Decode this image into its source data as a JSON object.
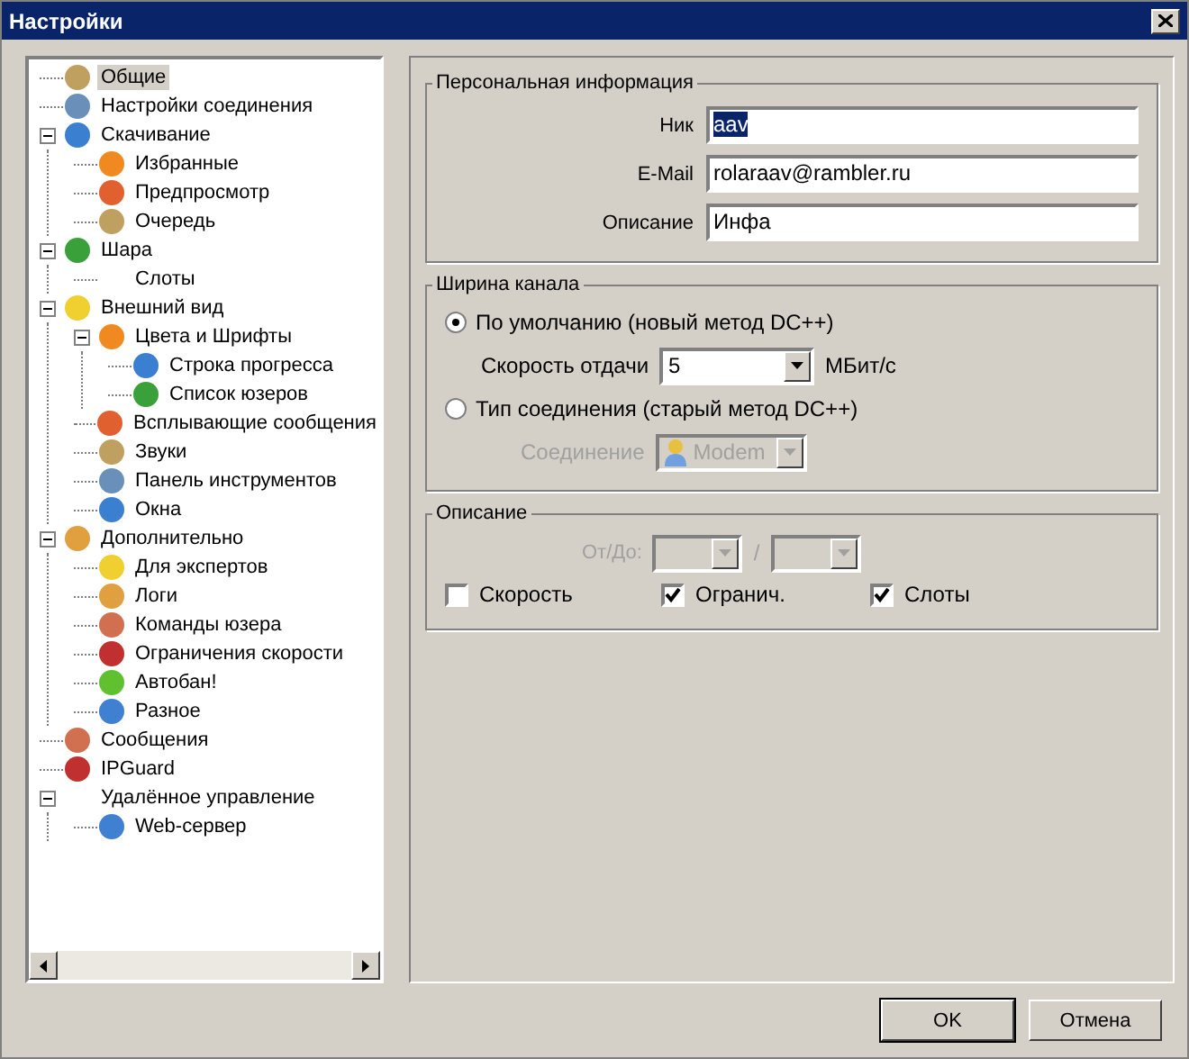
{
  "window": {
    "title": "Настройки"
  },
  "tree": [
    {
      "label": "Общие",
      "selected": true,
      "icon": true
    },
    {
      "label": "Настройки соединения",
      "selected": false,
      "icon": true
    },
    {
      "label": "Скачивание",
      "selected": false,
      "icon": true,
      "expanded": true,
      "children": [
        {
          "label": "Избранные",
          "selected": false,
          "icon": true
        },
        {
          "label": "Предпросмотр",
          "selected": false,
          "icon": true
        },
        {
          "label": "Очередь",
          "selected": false,
          "icon": true
        }
      ]
    },
    {
      "label": "Шара",
      "selected": false,
      "icon": true,
      "expanded": true,
      "children": [
        {
          "label": "Слоты",
          "selected": false,
          "icon": false
        }
      ]
    },
    {
      "label": "Внешний вид",
      "selected": false,
      "icon": true,
      "expanded": true,
      "children": [
        {
          "label": "Цвета и Шрифты",
          "selected": false,
          "icon": true,
          "expanded": true,
          "children": [
            {
              "label": "Строка прогресса",
              "selected": false,
              "icon": true
            },
            {
              "label": "Список юзеров",
              "selected": false,
              "icon": true
            }
          ]
        },
        {
          "label": "Всплывающие сообщения",
          "selected": false,
          "icon": true
        },
        {
          "label": "Звуки",
          "selected": false,
          "icon": true
        },
        {
          "label": "Панель инструментов",
          "selected": false,
          "icon": true
        },
        {
          "label": "Окна",
          "selected": false,
          "icon": true
        }
      ]
    },
    {
      "label": "Дополнительно",
      "selected": false,
      "icon": true,
      "expanded": true,
      "children": [
        {
          "label": "Для экспертов",
          "selected": false,
          "icon": true
        },
        {
          "label": "Логи",
          "selected": false,
          "icon": true
        },
        {
          "label": "Команды юзера",
          "selected": false,
          "icon": true
        },
        {
          "label": "Ограничения скорости",
          "selected": false,
          "icon": true
        },
        {
          "label": "Автобан!",
          "selected": false,
          "icon": true
        },
        {
          "label": "Разное",
          "selected": false,
          "icon": true
        }
      ]
    },
    {
      "label": "Сообщения",
      "selected": false,
      "icon": true
    },
    {
      "label": "IPGuard",
      "selected": false,
      "icon": true
    },
    {
      "label": "Удалённое управление",
      "selected": false,
      "icon": false,
      "expanded": true,
      "children": [
        {
          "label": "Web-сервер",
          "selected": false,
          "icon": true
        }
      ]
    }
  ],
  "personal": {
    "title": "Персональная информация",
    "fields": [
      {
        "label": "Ник",
        "value": "aav",
        "text_selected": true
      },
      {
        "label": "E-Mail",
        "value": "rolaraav@rambler.ru",
        "text_selected": false
      },
      {
        "label": "Описание",
        "value": "Инфа",
        "text_selected": false
      }
    ]
  },
  "bandwidth": {
    "title": "Ширина канала",
    "default_option": {
      "label": "По умолчанию (новый метод DC++)",
      "selected": true
    },
    "upload": {
      "label": "Скорость отдачи",
      "value": "5",
      "unit": "МБит/с",
      "disabled": false
    },
    "type_option": {
      "label": "Тип соединения (старый метод DC++)",
      "selected": false
    },
    "connection": {
      "label": "Соединение",
      "value": "Modem",
      "disabled": true
    }
  },
  "description": {
    "title": "Описание",
    "range": {
      "label": "От/До:",
      "separator": "/",
      "disabled": true
    },
    "checks": [
      {
        "label": "Скорость",
        "checked": false
      },
      {
        "label": "Огранич.",
        "checked": true
      },
      {
        "label": "Слоты",
        "checked": true
      }
    ]
  },
  "buttons": [
    {
      "label": "OK",
      "default": true
    },
    {
      "label": "Отмена",
      "default": false
    }
  ]
}
